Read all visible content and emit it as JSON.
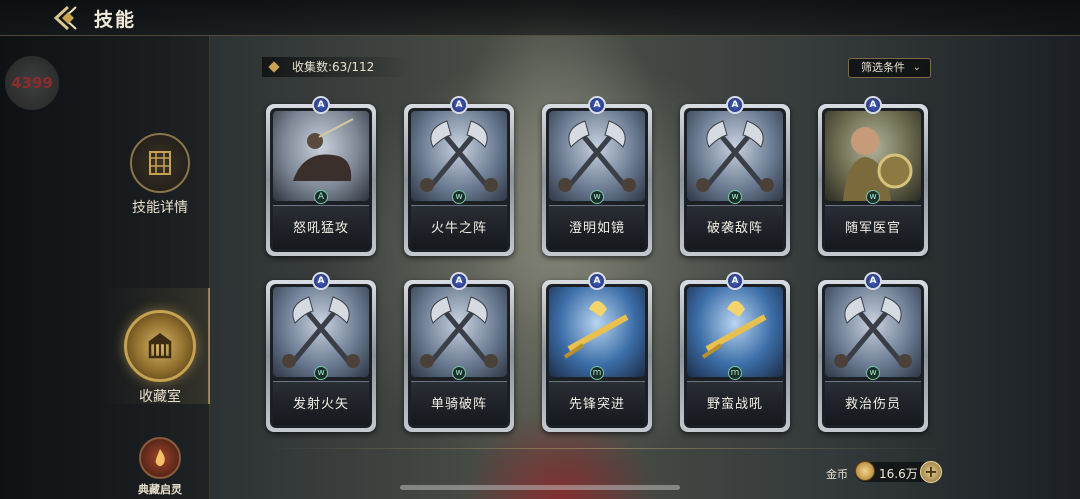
{
  "header": {
    "title": "技能"
  },
  "sidebar": {
    "logo_text": "4399",
    "items": [
      {
        "label": "技能详情",
        "icon": "skill-book-icon"
      },
      {
        "label": "收藏室",
        "icon": "collection-hall-icon",
        "active": true
      },
      {
        "label": "典藏启灵",
        "icon": "flame-icon"
      }
    ]
  },
  "collection": {
    "count_label": "收集数:63/112",
    "filter_label": "筛选条件"
  },
  "cards": [
    {
      "name": "怒吼猛攻",
      "art": "horse",
      "type_icon": "A"
    },
    {
      "name": "火牛之阵",
      "art": "axes",
      "type_icon": "w"
    },
    {
      "name": "澄明如镜",
      "art": "axes",
      "type_icon": "w"
    },
    {
      "name": "破袭敌阵",
      "art": "axes",
      "type_icon": "w"
    },
    {
      "name": "随军医官",
      "art": "hero",
      "type_icon": "w"
    },
    {
      "name": "发射火矢",
      "art": "axes",
      "type_icon": "w"
    },
    {
      "name": "单骑破阵",
      "art": "axes",
      "type_icon": "w"
    },
    {
      "name": "先锋突进",
      "art": "gold",
      "type_icon": "m"
    },
    {
      "name": "野蛮战吼",
      "art": "gold",
      "type_icon": "m"
    },
    {
      "name": "救治伤员",
      "art": "axes",
      "type_icon": "w"
    }
  ],
  "grade_badge": "A",
  "currency": {
    "label": "金币",
    "value": "16.6万",
    "add": "+"
  },
  "colors": {
    "accent_gold": "#c7a253",
    "badge_blue": "#3a55b8",
    "type_green": "#76c4a6"
  }
}
